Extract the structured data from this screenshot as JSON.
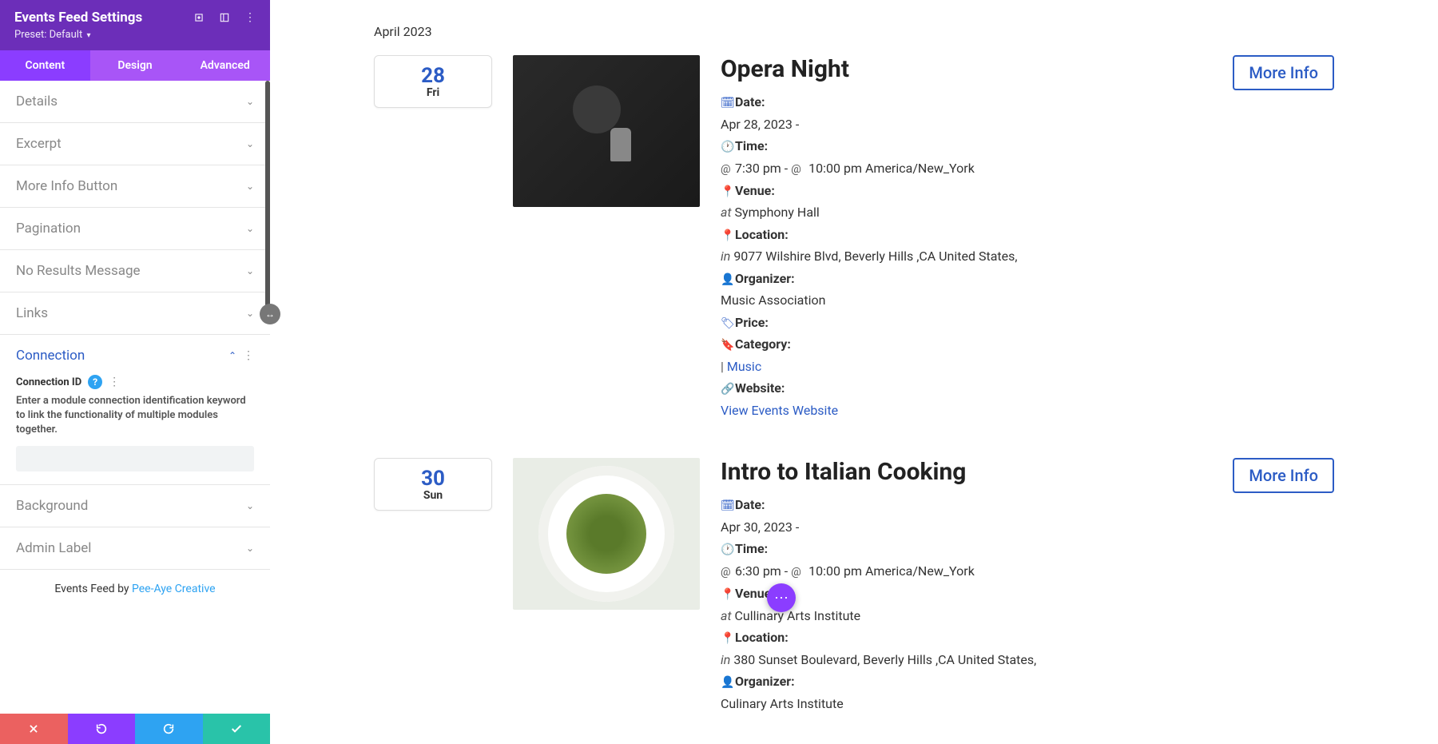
{
  "sidebar": {
    "title": "Events Feed Settings",
    "preset_label": "Preset: Default",
    "tabs": {
      "content": "Content",
      "design": "Design",
      "advanced": "Advanced"
    },
    "sections": {
      "details": "Details",
      "excerpt": "Excerpt",
      "more_info": "More Info Button",
      "pagination": "Pagination",
      "no_results": "No Results Message",
      "links": "Links",
      "connection": "Connection",
      "background": "Background",
      "admin_label": "Admin Label"
    },
    "connection_field": {
      "label": "Connection ID",
      "desc": "Enter a module connection identification keyword to link the functionality of multiple modules together.",
      "value": ""
    },
    "footer_prefix": "Events Feed by ",
    "footer_link": "Pee-Aye Creative"
  },
  "preview": {
    "month": "April 2023",
    "more_info": "More Info",
    "events": [
      {
        "day_num": "28",
        "day_name": "Fri",
        "title": "Opera Night",
        "date_label": "Date:",
        "date_val": "Apr 28, 2023 -",
        "time_label": "Time:",
        "time_val": "7:30 pm - ",
        "time_end": "10:00 pm America/New_York",
        "venue_label": "Venue:",
        "venue_prefix": "at",
        "venue_val": "Symphony Hall",
        "loc_label": "Location:",
        "loc_prefix": "in",
        "loc_val": "9077 Wilshire Blvd, Beverly Hills ,CA United States,",
        "org_label": "Organizer:",
        "org_val": "Music Association",
        "price_label": "Price:",
        "cat_label": "Category:",
        "cat_val": "Music",
        "web_label": "Website:",
        "web_link": "View Events Website"
      },
      {
        "day_num": "30",
        "day_name": "Sun",
        "title": "Intro to Italian Cooking",
        "date_label": "Date:",
        "date_val": "Apr 30, 2023 -",
        "time_label": "Time:",
        "time_val": "6:30 pm - ",
        "time_end": "10:00 pm America/New_York",
        "venue_label": "Venue:",
        "venue_prefix": "at",
        "venue_val": "Cullinary Arts Institute",
        "loc_label": "Location:",
        "loc_prefix": "in",
        "loc_val": "380 Sunset Boulevard, Beverly Hills ,CA United States,",
        "org_label": "Organizer:",
        "org_val": "Culinary Arts Institute"
      }
    ]
  }
}
